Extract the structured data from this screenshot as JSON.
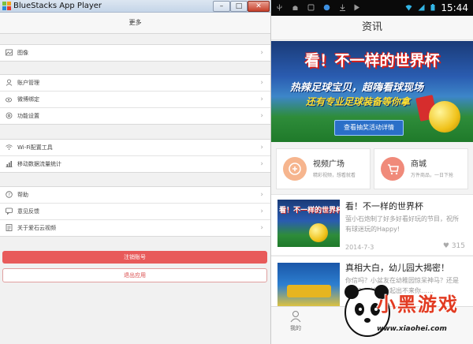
{
  "left_window": {
    "title": "BlueStacks App Player",
    "controls": {
      "minimize": "–",
      "maximize": "□",
      "close": "✕"
    },
    "header": "更多",
    "groups": [
      [
        {
          "label": "图像",
          "icon": "image-icon"
        }
      ],
      [
        {
          "label": "账户管理",
          "icon": "user-icon"
        },
        {
          "label": "微博绑定",
          "icon": "weibo-icon"
        },
        {
          "label": "功能设置",
          "icon": "settings-icon"
        }
      ],
      [
        {
          "label": "Wi-Fi配置工具",
          "icon": "wifi-icon"
        },
        {
          "label": "移动数据流量统计",
          "icon": "chart-icon"
        }
      ],
      [
        {
          "label": "帮助",
          "icon": "help-icon"
        },
        {
          "label": "意见反馈",
          "icon": "feedback-icon"
        },
        {
          "label": "关于爱石云视频",
          "icon": "info-icon"
        }
      ]
    ],
    "chevron": "›",
    "logout_button": "注销账号",
    "exit_button": "退出应用"
  },
  "phone": {
    "status_time": "15:44",
    "title": "资讯",
    "banner": {
      "headline": "看！不一样的世界杯",
      "line1": "热辣足球宝贝，超嗨看球现场",
      "line2": "还有专业足球装备等你拿",
      "button": "查看抽奖活动详情"
    },
    "tiles": [
      {
        "title": "视频广场",
        "subtitle": "精彩视频，想看就看",
        "color": "#f6b58e"
      },
      {
        "title": "商城",
        "subtitle": "万件商品，一日下抢",
        "color": "#f08a7a"
      }
    ],
    "news": [
      {
        "title": "看！不一样的世界杯",
        "desc": "萤小石炮制了好多好看好玩的节目，祝所有球迷玩的Happy!",
        "date": "2014-7-3",
        "likes": "315"
      },
      {
        "title": "真相大白，幼儿园大揭密！",
        "desc": "你信吗？小盆友在幼稚园惊呆神马？还是知道？不怕，一起出不来你……",
        "date": "",
        "likes": ""
      }
    ],
    "nav": [
      {
        "label": "我的"
      }
    ],
    "heart": "♥"
  },
  "watermark": {
    "text": "小黑游戏",
    "url": "www.xiaohei.com"
  },
  "colors": {
    "accent_red": "#e85a5a",
    "banner_blue": "#2a5cb0",
    "android_status": "#0a0a0a"
  }
}
